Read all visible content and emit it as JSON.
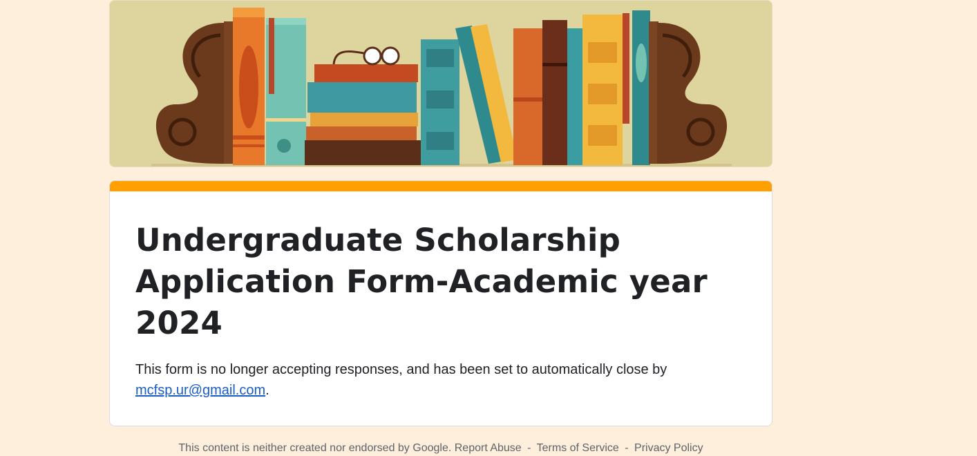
{
  "form": {
    "title": "Undergraduate Scholarship Application Form-Academic year 2024",
    "description_text": "This form is no longer accepting responses, and has been set to automatically close by",
    "owner_email": "mcfsp.ur@gmail.com",
    "description_end": "."
  },
  "footer": {
    "disclaimer": "This content is neither created nor endorsed by Google.",
    "report_abuse": "Report Abuse",
    "separator": "-",
    "terms": "Terms of Service",
    "privacy": "Privacy Policy"
  },
  "colors": {
    "background": "#fdefdc",
    "accent": "#ffa000",
    "link": "#1a5cc7"
  },
  "banner": {
    "icon": "bookshelf-illustration"
  }
}
